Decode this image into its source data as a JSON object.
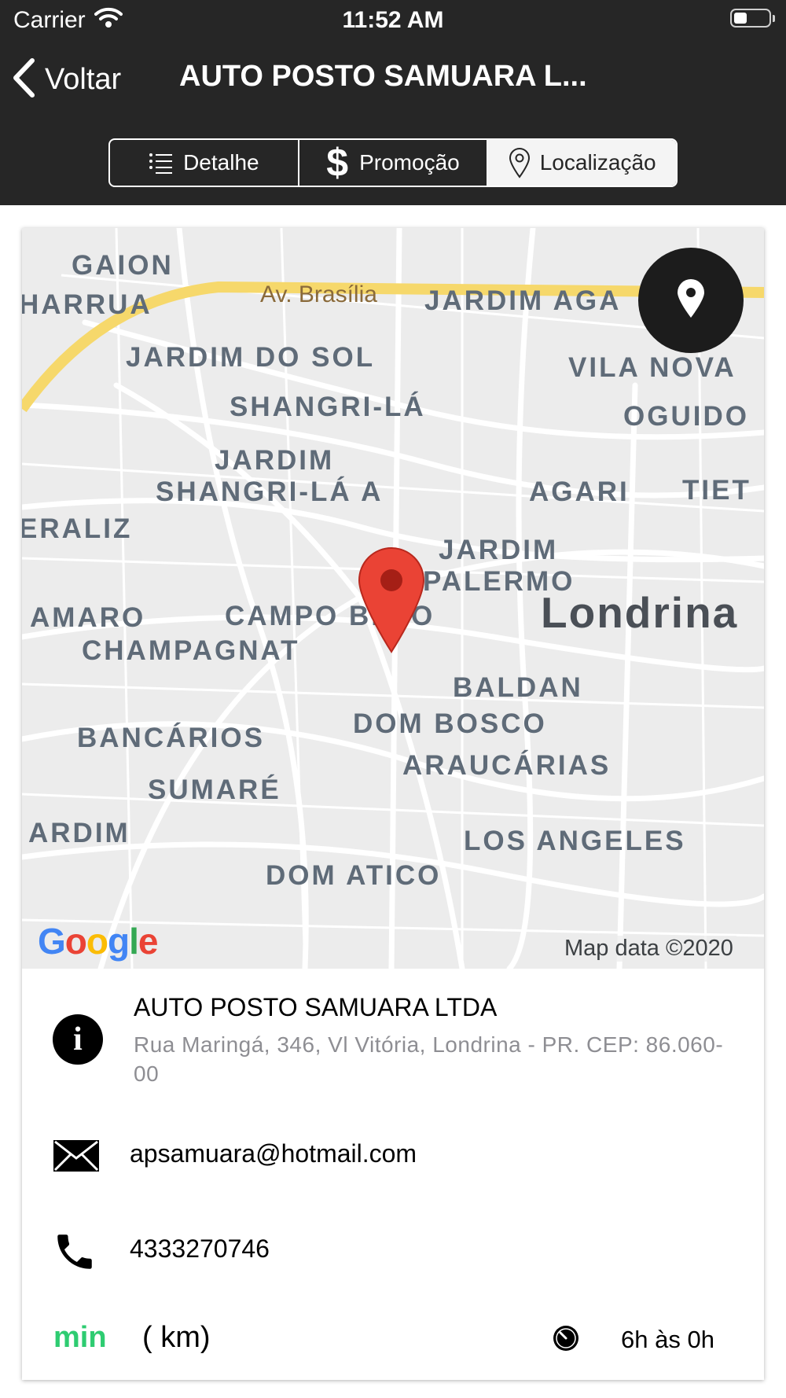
{
  "status_bar": {
    "carrier": "Carrier",
    "time": "11:52 AM"
  },
  "nav": {
    "back_label": "Voltar",
    "title": "AUTO POSTO SAMUARA L..."
  },
  "tabs": [
    {
      "label": "Detalhe",
      "icon": "list-icon"
    },
    {
      "label": "Promoção",
      "icon": "dollar-icon"
    },
    {
      "label": "Localização",
      "icon": "map-pin-icon",
      "active": true
    }
  ],
  "map": {
    "labels": {
      "gaion": "GAION",
      "harrua": "HARRUA",
      "av_brasilia": "Av. Brasília",
      "jardim_aga": "JARDIM AGA",
      "jardim_do_sol": "JARDIM DO SOL",
      "vila_nova": "VILA NOVA",
      "shangri_la": "SHANGRI-LÁ",
      "oguido": "OGUIDO",
      "jardim": "JARDIM",
      "shangri_la_a": "SHANGRI-LÁ A",
      "agari": "AGARI",
      "tiet": "TIET",
      "eraliz": "ERALIZ",
      "jardim2": "JARDIM",
      "palermo": "PALERMO",
      "amaro": "AMARO",
      "campo_belo": "CAMPO BELO",
      "londrina": "Londrina",
      "champagnat": "CHAMPAGNAT",
      "baldan": "BALDAN",
      "dom_bosco": "DOM BOSCO",
      "bancarios": "BANCÁRIOS",
      "araucarias": "ARAUCÁRIAS",
      "sumare": "SUMARÉ",
      "ardim": "ARDIM",
      "los_angeles": "LOS ANGELES",
      "dom_atico": "DOM ATICO"
    },
    "google_logo": [
      "G",
      "o",
      "o",
      "g",
      "l",
      "e"
    ],
    "credit": "Map data ©2020"
  },
  "station": {
    "name": "AUTO POSTO SAMUARA LTDA",
    "address": "Rua Maringá, 346, Vl Vitória, Londrina - PR. CEP: 86.060-00",
    "email": "apsamuara@hotmail.com",
    "phone": "4333270746",
    "time_unit": "min",
    "distance": "( km)",
    "hours": "6h às 0h"
  },
  "colors": {
    "header_bg": "#262626",
    "min_green": "#2ecc71",
    "pin_red": "#ea4335",
    "address_gray": "#8e8e93"
  }
}
